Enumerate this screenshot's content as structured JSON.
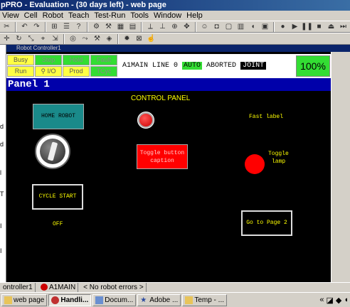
{
  "window": {
    "title": "pPRO - Evaluation - (30 days left) - web page"
  },
  "menu": [
    "View",
    "Cell",
    "Robot",
    "Teach",
    "Test-Run",
    "Tools",
    "Window",
    "Help"
  ],
  "child_window": {
    "title": "Robot Controller1"
  },
  "status_leds": {
    "busy": "Busy",
    "step": "Step",
    "hold": "Hold",
    "fault": "Fault",
    "run": "Run",
    "io": "I/O",
    "prod": "Prod",
    "tcyc": "TCyc"
  },
  "status_line": {
    "program": "A1MAIN",
    "line": "LINE 0",
    "mode": "AUTO",
    "state": "ABORTED",
    "coord": "JOINT"
  },
  "override": "100%",
  "panel": {
    "header": "Panel 1",
    "title": "CONTROL PANEL",
    "home_robot": "HOME ROBOT",
    "toggle_button_line1": "Toggle button",
    "toggle_button_line2": "caption",
    "fast_label": "Fast label",
    "toggle_lamp_line1": "Toggle",
    "toggle_lamp_line2": "lamp",
    "cycle_start": "CYCLE START",
    "off_label": "OFF",
    "goto_page2": "Go to Page 2"
  },
  "statusbar": {
    "controller": "ontroller1",
    "program": "A1MAIN",
    "message": "< No robot errors >"
  },
  "taskbar": {
    "items": [
      "web page",
      "Handli...",
      "Docum...",
      "Adobe ...",
      "Temp - ..."
    ],
    "tray_text": "«"
  },
  "colors": {
    "panel_bg": "#000000",
    "panel_header": "#0000aa",
    "text_yellow": "#ffff00",
    "lamp_red": "#ff0000",
    "teal_button": "#1a8a8a",
    "status_green": "#33dd33"
  }
}
